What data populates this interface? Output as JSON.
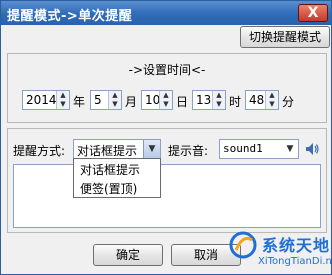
{
  "window": {
    "title": "提醒模式->单次提醒",
    "close_label": "X"
  },
  "toolbar": {
    "toggle_label": "切换提醒模式"
  },
  "time": {
    "section_title": "->设置时间<-",
    "year": "2014",
    "year_unit": "年",
    "month": "5",
    "month_unit": "月",
    "day": "10",
    "day_unit": "日",
    "hour": "13",
    "hour_unit": "时",
    "minute": "48",
    "minute_unit": "分"
  },
  "remind": {
    "mode_label": "提醒方式:",
    "mode_value": "对话框提示",
    "mode_options": [
      "对话框提示",
      "便签(置顶)"
    ],
    "sound_label": "提示音:",
    "sound_value": "sound1"
  },
  "buttons": {
    "ok": "确定",
    "cancel": "取消"
  },
  "watermark": {
    "text": "系统天地",
    "url": "XiTongTianDi.net"
  },
  "icons": {
    "spin_up": "up-arrow-icon",
    "spin_down": "down-arrow-icon",
    "combo": "chevron-down-icon",
    "speaker": "speaker-icon"
  }
}
